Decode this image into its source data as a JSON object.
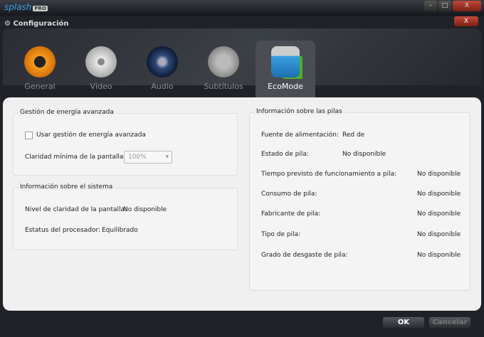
{
  "app": {
    "logo": "splash",
    "logo_badge": "PRO",
    "minimize": "–",
    "maximize": "□",
    "close": "X"
  },
  "dialog": {
    "title": "⚙ Configuración",
    "close": "X"
  },
  "tabs": [
    {
      "label": "General",
      "color": "#f39a1e"
    },
    {
      "label": "Vídeo",
      "color": "#cfcfcf"
    },
    {
      "label": "Audio",
      "color": "#2e4a7a"
    },
    {
      "label": "Subtítulos",
      "color": "#9a9a9a"
    },
    {
      "label": "EcoMode",
      "color": "#3aa0e0"
    }
  ],
  "power": {
    "title": "Gestión de energía avanzada",
    "checkbox_label": "Usar gestión de energía avanzada",
    "checked": false,
    "clarity_label": "Claridad mínima de la pantalla:",
    "clarity_value": "100%",
    "arrow": "▾"
  },
  "system": {
    "title": "Información sobre el sistema",
    "rows": [
      {
        "label": "Nivel de claridad de la pantalla:",
        "value": "No disponible"
      },
      {
        "label": "Estatus del procesador:",
        "value": "Equilibrado"
      }
    ]
  },
  "battery": {
    "title": "Información sobre las pilas",
    "rows": [
      {
        "label": "Fuente de alimentación:",
        "value": "Red de"
      },
      {
        "label": "Estado de pila:",
        "value": "No disponible"
      },
      {
        "label": "Tiempo previsto de funcionamiento a pila:",
        "value": "No disponible"
      },
      {
        "label": "Consumo de pila:",
        "value": "No disponible"
      },
      {
        "label": "Fabricante de pila:",
        "value": "No disponible"
      },
      {
        "label": "Tipo de pila:",
        "value": "No disponible"
      },
      {
        "label": "Grado de desgaste de pila:",
        "value": "No disponible"
      }
    ]
  },
  "buttons": {
    "ok": "OK",
    "cancel": "Cancelar"
  }
}
